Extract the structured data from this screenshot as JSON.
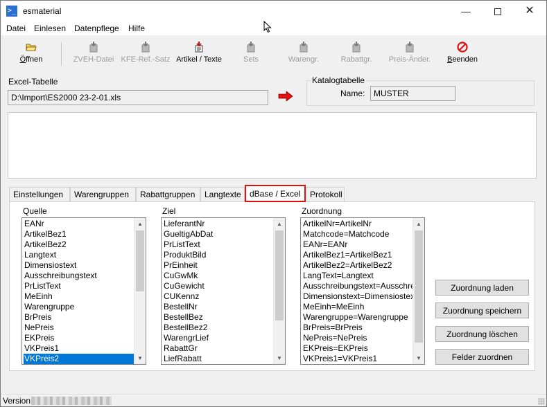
{
  "window": {
    "title": "esmaterial",
    "app_icon": "terminal-app-icon",
    "min_glyph": "—",
    "close_glyph": "✕"
  },
  "menu": [
    "Datei",
    "Einlesen",
    "Datenpflege",
    "Hilfe"
  ],
  "toolbar": [
    {
      "label": "Öffnen",
      "icon": "folder-open-icon",
      "enabled": true
    },
    {
      "label": "ZVEH-Datei",
      "icon": "import-arrow-icon",
      "enabled": false
    },
    {
      "label": "KFE-Ref.-Satz",
      "icon": "import-arrow-icon",
      "enabled": false
    },
    {
      "label": "Artikel / Texte",
      "icon": "import-arrow-icon",
      "enabled": true
    },
    {
      "label": "Sets",
      "icon": "import-arrow-icon",
      "enabled": false
    },
    {
      "label": "Warengr.",
      "icon": "import-arrow-icon",
      "enabled": false
    },
    {
      "label": "Rabattgr.",
      "icon": "import-arrow-icon",
      "enabled": false
    },
    {
      "label": "Preis-Änder.",
      "icon": "import-arrow-icon",
      "enabled": false
    },
    {
      "label": "Beenden",
      "icon": "stop-icon",
      "enabled": true
    }
  ],
  "excel": {
    "label": "Excel-Tabelle",
    "path": "D:\\Import\\ES2000 23-2-01.xls"
  },
  "katalog": {
    "label": "Katalogtabelle",
    "name_label": "Name:",
    "name_value": "MUSTER"
  },
  "tabs": [
    {
      "label": "Einstellungen",
      "active": false
    },
    {
      "label": "Warengruppen",
      "active": false
    },
    {
      "label": "Rabattgruppen",
      "active": false
    },
    {
      "label": "Langtexte",
      "active": false
    },
    {
      "label": "dBase / Excel",
      "active": true
    },
    {
      "label": "Protokoll",
      "active": false
    }
  ],
  "lists": {
    "quelle": {
      "label": "Quelle",
      "selected_index": 13,
      "items": [
        "EANr",
        "ArtikelBez1",
        "ArtikelBez2",
        "Langtext",
        "Dimensiostext",
        "Ausschreibungstext",
        "PrListText",
        "MeEinh",
        "Warengruppe",
        "BrPreis",
        "NePreis",
        "EKPreis",
        "VKPreis1",
        "VKPreis2"
      ]
    },
    "ziel": {
      "label": "Ziel",
      "items": [
        "LieferantNr",
        "GueltigAbDat",
        "PrListText",
        "ProduktBild",
        "PrEinheit",
        "CuGwMk",
        "CuGewicht",
        "CUKennz",
        "BestellNr",
        "BestellBez",
        "BestellBez2",
        "WarengrLief",
        "RabattGr",
        "LiefRabatt"
      ]
    },
    "zuordnung": {
      "label": "Zuordnung",
      "items": [
        "ArtikelNr=ArtikelNr",
        "Matchcode=Matchcode",
        "EANr=EANr",
        "ArtikelBez1=ArtikelBez1",
        "ArtikelBez2=ArtikelBez2",
        "LangText=Langtext",
        "Ausschreibungstext=Ausschreibungstext",
        "Dimensionstext=Dimensiostext",
        "MeEinh=MeEinh",
        "Warengruppe=Warengruppe",
        "BrPreis=BrPreis",
        "NePreis=NePreis",
        "EKPreis=EKPreis",
        "VKPreis1=VKPreis1"
      ]
    }
  },
  "buttons": {
    "laden": "Zuordnung laden",
    "speichern": "Zuordnung speichern",
    "loeschen": "Zuordnung löschen",
    "felder": "Felder zuordnen"
  },
  "status": {
    "version_label": "Version"
  },
  "colors": {
    "selection": "#0078d7",
    "highlight_tab_border": "#e01010",
    "stop": "#e01010",
    "arrow": "#e01010"
  }
}
